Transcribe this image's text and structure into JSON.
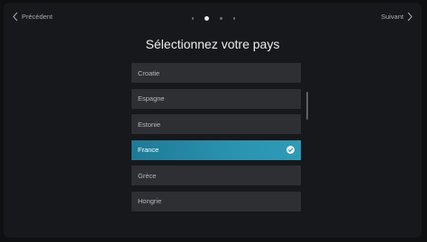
{
  "nav": {
    "prev_label": "Précédent",
    "next_label": "Suivant"
  },
  "pagination": {
    "total": 4,
    "active_index": 1
  },
  "title": "Sélectionnez votre pays",
  "countries": [
    {
      "label": "Croatie",
      "selected": false
    },
    {
      "label": "Espagne",
      "selected": false
    },
    {
      "label": "Estonie",
      "selected": false
    },
    {
      "label": "France",
      "selected": true
    },
    {
      "label": "Grèce",
      "selected": false
    },
    {
      "label": "Hongrie",
      "selected": false
    }
  ],
  "colors": {
    "accent": "#2a93b0",
    "background": "#17181b",
    "item": "#2d2f33"
  }
}
